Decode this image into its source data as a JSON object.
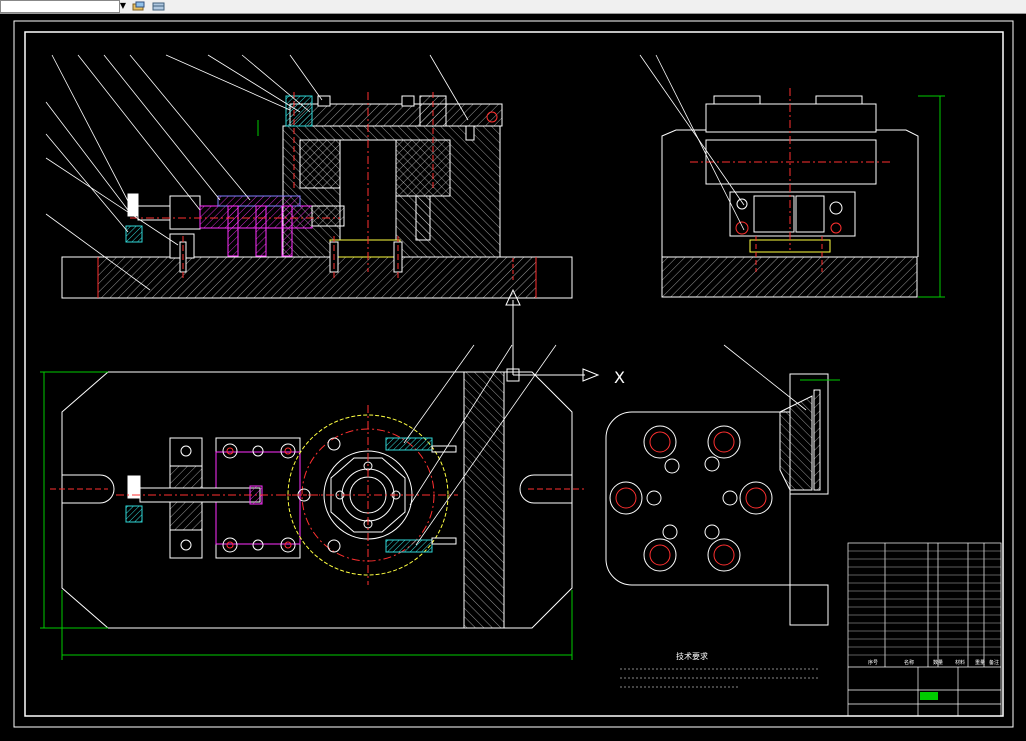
{
  "toolbar": {
    "layer_combo_value": "",
    "icons": [
      "layer-state-icon",
      "layer-properties-icon"
    ]
  },
  "drawing": {
    "axis_label_x": "X",
    "tech_requirements": {
      "title": "技术要求",
      "lines": [
        "",
        "",
        ""
      ]
    },
    "title_block": {
      "header_cells": [
        "序号",
        "代号",
        "名称",
        "数量",
        "材料",
        "重量",
        "备注"
      ]
    },
    "colors": {
      "background": "#000000",
      "outline": "#ffffff",
      "centerline": "#ff3030",
      "hatch": "#ffffff",
      "dimension": "#00cc00",
      "part_magenta": "#ff30ff",
      "part_cyan": "#30d8d8",
      "part_yellow": "#ffff40",
      "leader": "#ffffff",
      "frame": "#ffffff"
    }
  }
}
